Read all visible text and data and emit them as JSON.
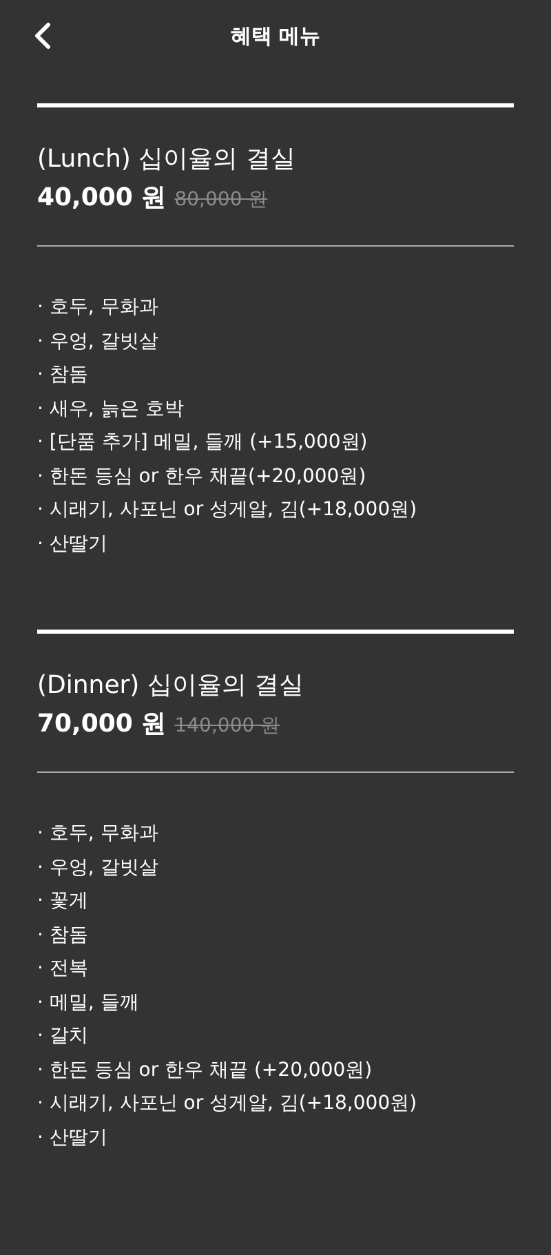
{
  "header": {
    "title": "혜택 메뉴"
  },
  "sections": [
    {
      "title": "(Lunch)  십이율의 결실",
      "price": "40,000 원",
      "original_price": "80,000 원",
      "items": [
        "· 호두, 무화과",
        "· 우엉, 갈빗살",
        "· 참돔",
        "· 새우, 늙은 호박",
        "· [단품 추가] 메밀, 들깨 (+15,000원)",
        "· 한돈 등심 or 한우 채끝(+20,000원)",
        "· 시래기, 사포닌 or 성게알, 김(+18,000원)",
        "· 산딸기"
      ]
    },
    {
      "title": "(Dinner)  십이율의 결실",
      "price": "70,000 원",
      "original_price": "140,000 원",
      "items": [
        "· 호두, 무화과",
        "· 우엉, 갈빗살",
        "· 꽃게",
        "· 참돔",
        "· 전복",
        "· 메밀, 들깨",
        "· 갈치",
        "· 한돈 등심 or 한우 채끝 (+20,000원)",
        "· 시래기, 사포닌 or 성게알, 김(+18,000원)",
        "· 산딸기"
      ]
    }
  ]
}
